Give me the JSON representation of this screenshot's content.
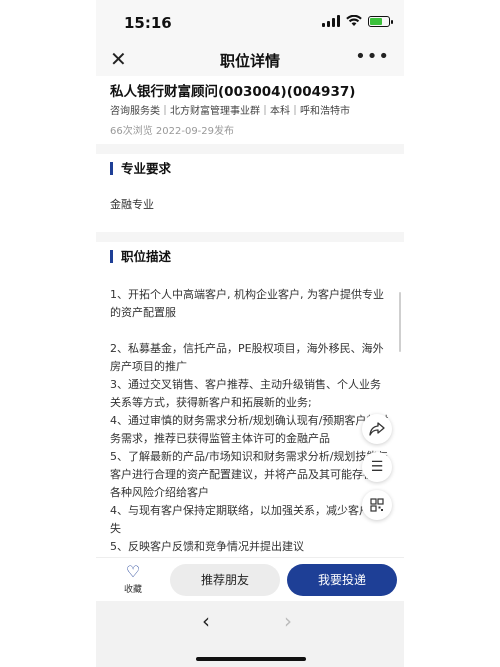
{
  "status_bar": {
    "time": "15:16"
  },
  "nav": {
    "title": "职位详情",
    "close_icon": "close-icon",
    "more_icon": "more-icon"
  },
  "job": {
    "title": "私人银行财富顾问(003004)(004937)",
    "tags": "咨询服务类｜北方财富管理事业群｜本科｜呼和浩特市",
    "meta": "66次浏览  2022-09-29发布"
  },
  "requirements": {
    "heading": "专业要求",
    "body": "金融专业"
  },
  "description": {
    "heading": "职位描述",
    "items": [
      "1、开拓个人中高端客户, 机构企业客户, 为客户提供专业的资产配置服",
      "2、私募基金，信托产品，PE股权项目，海外移民、海外房产项目的推广",
      "3、通过交叉销售、客户推荐、主动升级销售、个人业务关系等方式，获得新客户和拓展新的业务;",
      "4、通过审慎的财务需求分析/规划确认现有/预期客户的财务需求，推荐已获得监管主体许可的金融产品",
      "5、了解最新的产品/市场知识和财务需求分析/规划技能与客户进行合理的资产配置建议，并将产品及其可能存在的各种风险介绍给客户",
      "4、与现有客户保持定期联络，以加强关系，减少客户流失",
      "5、反映客户反馈和竞争情况并提出建议"
    ]
  },
  "actions": {
    "favorite": "收藏",
    "recommend": "推荐朋友",
    "apply": "我要投递"
  },
  "colors": {
    "brand": "#1e3f96",
    "battery": "#3cc13c"
  }
}
